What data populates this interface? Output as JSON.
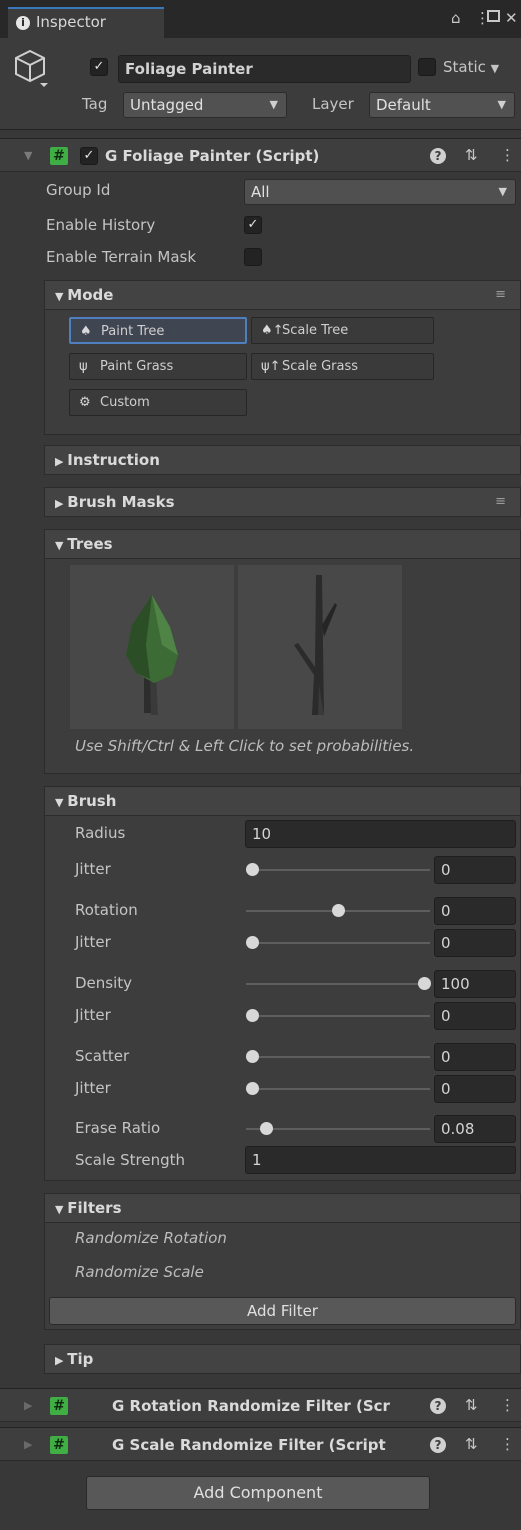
{
  "tab": {
    "label": "Inspector",
    "info_icon": "info-icon",
    "icons": [
      "lock-icon",
      "kebab-icon",
      "maximize-icon",
      "close-icon"
    ]
  },
  "header": {
    "object_enabled": true,
    "object_name": "Foliage Painter",
    "static_label": "Static",
    "tag_label": "Tag",
    "tag_value": "Untagged",
    "layer_label": "Layer",
    "layer_value": "Default"
  },
  "component": {
    "title": "G Foliage Painter (Script)",
    "enabled": true,
    "group_id_label": "Group Id",
    "group_id_value": "All",
    "enable_history_label": "Enable History",
    "enable_history": true,
    "enable_terrain_mask_label": "Enable Terrain Mask",
    "enable_terrain_mask": false
  },
  "mode": {
    "title": "Mode",
    "buttons": [
      {
        "label": "Paint Tree",
        "icon": "paint-tree-icon",
        "selected": true
      },
      {
        "label": "Scale Tree",
        "icon": "scale-tree-icon",
        "selected": false
      },
      {
        "label": "Paint Grass",
        "icon": "paint-grass-icon",
        "selected": false
      },
      {
        "label": "Scale Grass",
        "icon": "scale-grass-icon",
        "selected": false
      },
      {
        "label": "Custom",
        "icon": "gear-icon",
        "selected": false
      }
    ]
  },
  "instruction": {
    "title": "Instruction"
  },
  "brush_masks": {
    "title": "Brush Masks"
  },
  "trees": {
    "title": "Trees",
    "hint": "Use Shift/Ctrl & Left Click to set probabilities.",
    "prototypes": [
      "leafy-tree-thumbnail",
      "bare-tree-thumbnail"
    ]
  },
  "brush": {
    "title": "Brush",
    "radius_label": "Radius",
    "radius_value": "10",
    "sliders": [
      {
        "label": "Jitter",
        "value": "0",
        "fraction": 0.0
      },
      {
        "label": "Rotation",
        "value": "0",
        "fraction": 0.5
      },
      {
        "label": "Jitter",
        "value": "0",
        "fraction": 0.0
      },
      {
        "label": "Density",
        "value": "100",
        "fraction": 1.0
      },
      {
        "label": "Jitter",
        "value": "0",
        "fraction": 0.0
      },
      {
        "label": "Scatter",
        "value": "0",
        "fraction": 0.0
      },
      {
        "label": "Jitter",
        "value": "0",
        "fraction": 0.0
      },
      {
        "label": "Erase Ratio",
        "value": "0.08",
        "fraction": 0.08
      }
    ],
    "scale_strength_label": "Scale Strength",
    "scale_strength_value": "1"
  },
  "filters": {
    "title": "Filters",
    "items": [
      "Randomize Rotation",
      "Randomize Scale"
    ],
    "add_label": "Add Filter"
  },
  "tip": {
    "title": "Tip"
  },
  "other_components": [
    {
      "title": "G Rotation Randomize Filter (Scr"
    },
    {
      "title": "G Scale Randomize Filter (Script"
    }
  ],
  "add_component_label": "Add Component",
  "colors": {
    "accent": "#3a79bb",
    "script_icon": "#3fae45",
    "background": "#383838"
  }
}
